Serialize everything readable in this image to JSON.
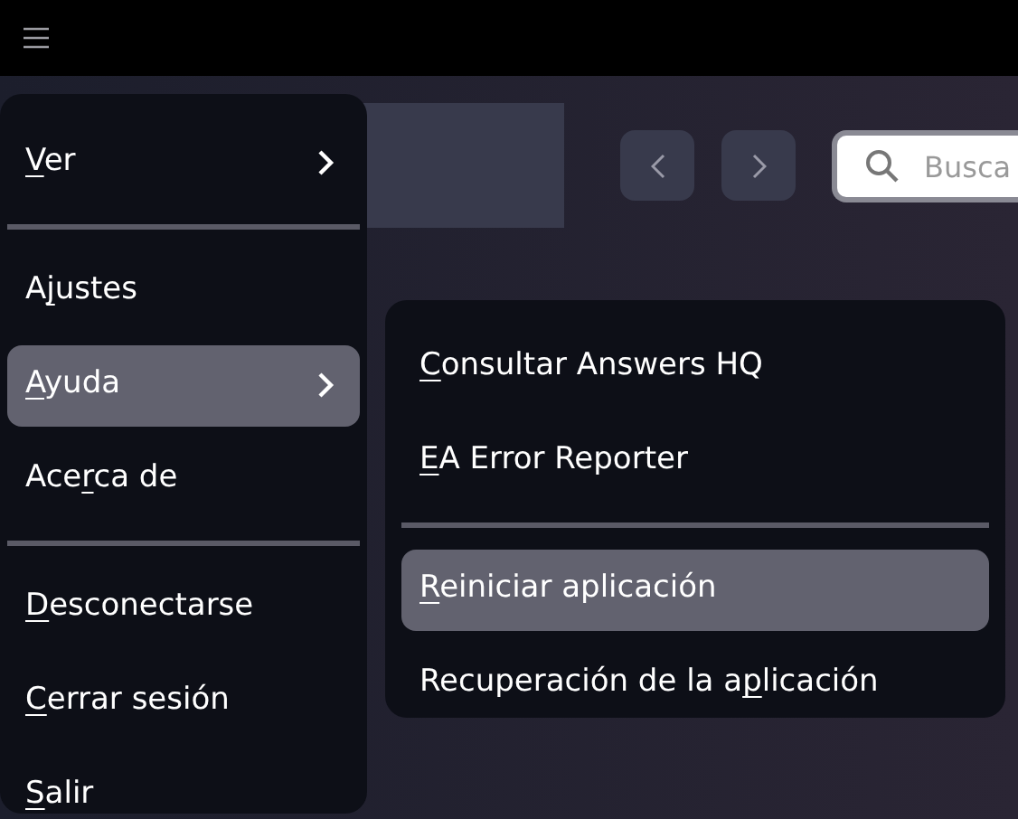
{
  "search": {
    "placeholder": "Busca"
  },
  "menu": [
    {
      "kind": "item",
      "key": "V",
      "after": "er",
      "submenu": true,
      "selected": false
    },
    {
      "kind": "separator"
    },
    {
      "kind": "item",
      "before": "A",
      "key": "j",
      "after": "ustes",
      "submenu": false,
      "selected": false
    },
    {
      "kind": "item",
      "key": "A",
      "after": "yuda",
      "submenu": true,
      "selected": true
    },
    {
      "kind": "item",
      "before": "Ace",
      "key": "r",
      "after": "ca de",
      "submenu": false,
      "selected": false
    },
    {
      "kind": "separator"
    },
    {
      "kind": "item",
      "key": "D",
      "after": "esconectarse",
      "submenu": false,
      "selected": false
    },
    {
      "kind": "item",
      "key": "C",
      "after": "errar sesión",
      "submenu": false,
      "selected": false
    },
    {
      "kind": "item",
      "key": "S",
      "after": "alir",
      "submenu": false,
      "selected": false
    }
  ],
  "submenu": [
    {
      "kind": "item",
      "key": "C",
      "after": "onsultar Answers HQ",
      "selected": false
    },
    {
      "kind": "item",
      "key": "E",
      "after": "A Error Reporter",
      "selected": false
    },
    {
      "kind": "separator"
    },
    {
      "kind": "item",
      "key": "R",
      "after": "einiciar aplicación",
      "selected": true
    },
    {
      "kind": "item",
      "before": "Recuperación de la a",
      "key": "p",
      "after": "licación",
      "selected": false
    }
  ]
}
